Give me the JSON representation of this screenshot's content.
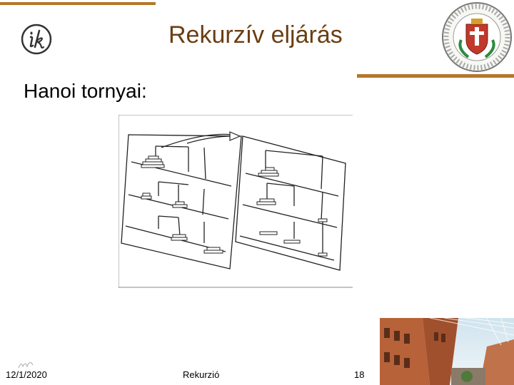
{
  "slide": {
    "title": "Rekurzív eljárás",
    "subtitle": "Hanoi tornyai:"
  },
  "footer": {
    "date": "12/1/2020",
    "center": "Rekurzió",
    "page": "18"
  },
  "icons": {
    "logo": "ik-logo-icon",
    "seal": "university-seal-icon"
  },
  "colors": {
    "accent": "#b5772a",
    "title": "#6b3e12"
  }
}
